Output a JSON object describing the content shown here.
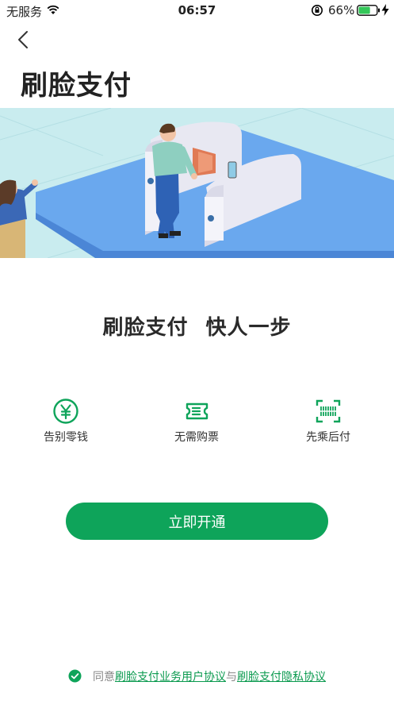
{
  "status_bar": {
    "carrier": "无服务",
    "time": "06:57",
    "battery_percent": "66%",
    "battery_level": 0.66
  },
  "header": {
    "back_icon": "chevron-left-icon",
    "title": "刷脸支付"
  },
  "hero": {
    "illustration": "face-pay-subway-gate-illustration"
  },
  "slogan": {
    "part1": "刷脸支付",
    "part2": "快人一步"
  },
  "features": [
    {
      "icon": "yuan-coin-icon",
      "label": "告别零钱"
    },
    {
      "icon": "ticket-icon",
      "label": "无需购票"
    },
    {
      "icon": "barcode-scan-icon",
      "label": "先乘后付"
    }
  ],
  "cta": {
    "label": "立即开通"
  },
  "agreement": {
    "prefix": "同意",
    "link1": "刷脸支付业务用户协议",
    "connector": "与",
    "link2": "刷脸支付隐私协议"
  },
  "colors": {
    "accent": "#0ea45a",
    "link": "#0b9a4f",
    "hero_bg": "#c9ecef",
    "hero_platform": "#6aa8ee"
  }
}
